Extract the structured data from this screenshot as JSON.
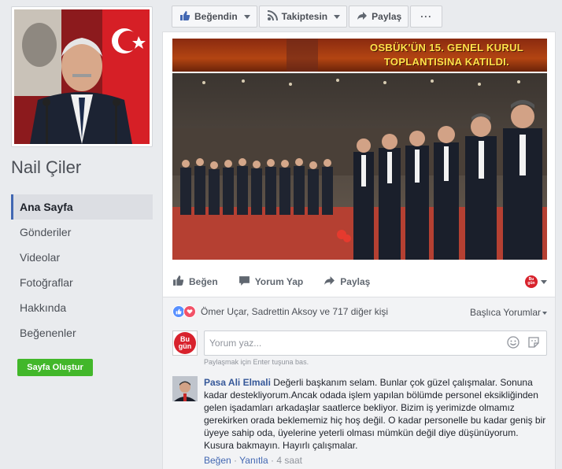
{
  "page": {
    "name": "Nail Çiler"
  },
  "nav": {
    "items": [
      "Ana Sayfa",
      "Gönderiler",
      "Videolar",
      "Fotoğraflar",
      "Hakkında",
      "Beğenenler"
    ],
    "active": "Ana Sayfa",
    "create_page": "Sayfa Oluştur"
  },
  "actionbar": {
    "like": "Beğendin",
    "follow": "Takiptesin",
    "share": "Paylaş",
    "more": "···"
  },
  "post": {
    "banner_line1": "OSBÜK'ÜN 15. GENEL KURUL",
    "banner_line2": "TOPLANTISINA KATILDI.",
    "actions": {
      "like": "Beğen",
      "comment": "Yorum Yap",
      "share": "Paylaş"
    },
    "reactions_text": "Ömer Uçar, Sadrettin Aksoy ve 717 diğer kişi",
    "sort_label": "Başlıca Yorumlar",
    "comment_placeholder": "Yorum yaz...",
    "comment_hint": "Paylaşmak için Enter tuşuna bas.",
    "page_avatar_text_1": "Bu",
    "page_avatar_text_2": "gün"
  },
  "comment": {
    "author": "Pasa Ali Elmali",
    "text": "Değerli başkanım selam. Bunlar çok güzel çalışmalar. Sonuna kadar destekliyorum.Ancak odada işlem yapılan bölümde personel eksikliğinden gelen işadamları arkadaşlar saatlerce bekliyor. Bizim iş yerimizde olmamız gerekirken orada beklememiz hiç hoş değil. O kadar personelle bu kadar geniş bir üyeye sahip oda, üyelerine yeterli olması mümkün değil diye düşünüyorum. Kusura bakmayın. Hayırlı çalışmalar.",
    "like": "Beğen",
    "reply": "Yanıtla",
    "time": "4 saat"
  },
  "colors": {
    "accent": "#4267b2",
    "create_button": "#42b72a",
    "banner_text": "#ffe24a"
  }
}
